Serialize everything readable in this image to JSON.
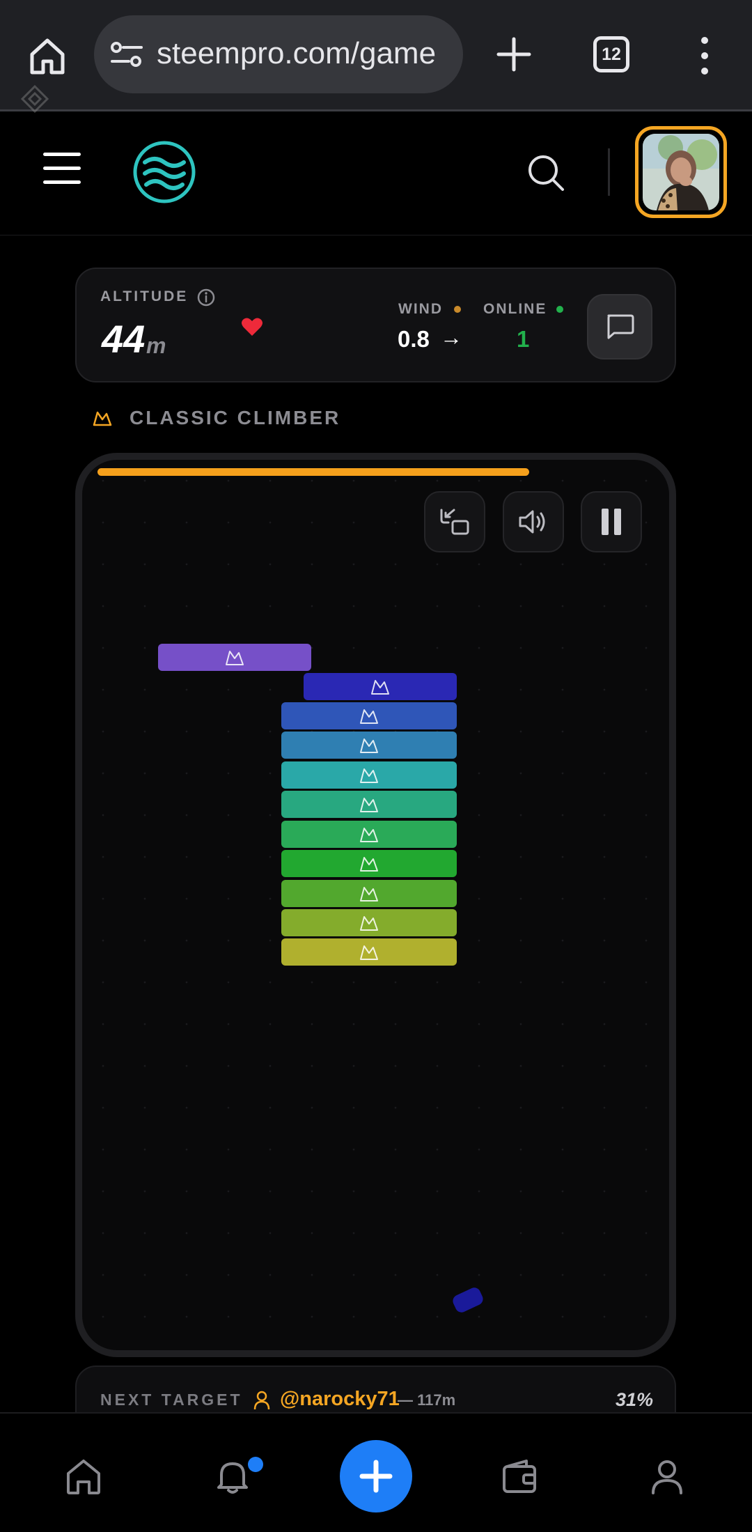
{
  "browser": {
    "url": "steempro.com/game",
    "tab_count": "12"
  },
  "stats": {
    "altitude_label": "ALTITUDE",
    "altitude_value": "44",
    "altitude_unit": "m",
    "wind_label": "WIND",
    "wind_value": "0.8",
    "wind_arrow": "→",
    "online_label": "ONLINE",
    "online_value": "1"
  },
  "mode": {
    "label": "CLASSIC CLIMBER"
  },
  "game": {
    "progress_fraction": 0.74,
    "blocks": [
      {
        "color": "#7650c8"
      },
      {
        "color": "#2a28b4"
      },
      {
        "color": "#2f56b8"
      },
      {
        "color": "#2f7fb2"
      },
      {
        "color": "#2aa8a8"
      },
      {
        "color": "#28a880"
      },
      {
        "color": "#2aaa58"
      },
      {
        "color": "#22a830"
      },
      {
        "color": "#52a82e"
      },
      {
        "color": "#84ac2c"
      },
      {
        "color": "#b0b02e"
      }
    ]
  },
  "next_target": {
    "label": "NEXT TARGET",
    "user": "@narocky71",
    "distance": "— 117m",
    "percent": "31%"
  },
  "colors": {
    "accent": "#f5a623",
    "primary": "#1e7ef7",
    "online": "#22b14c"
  }
}
